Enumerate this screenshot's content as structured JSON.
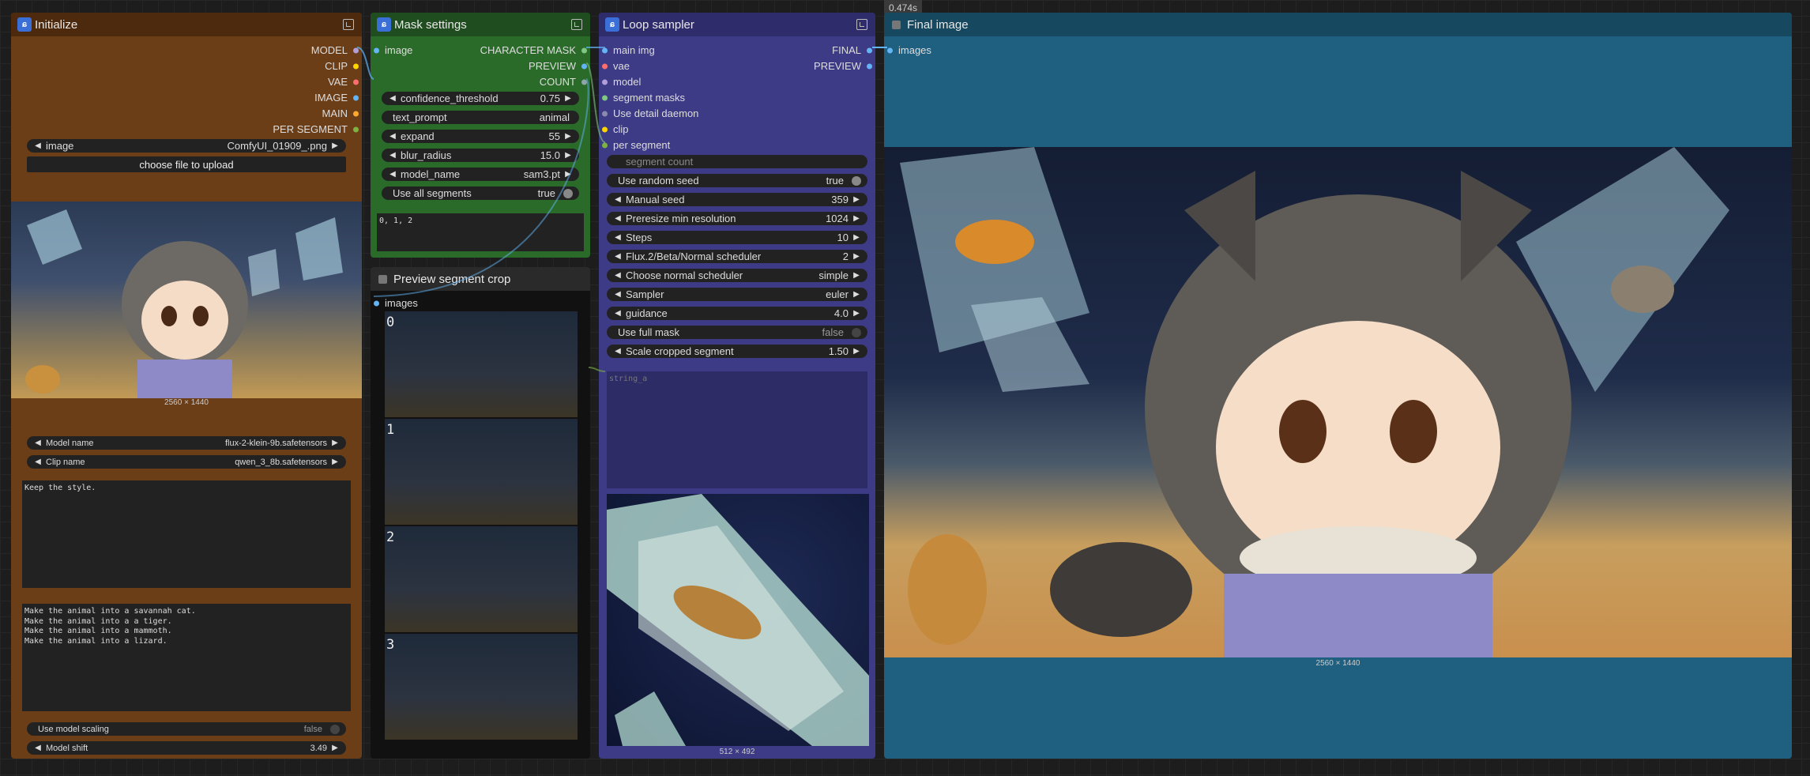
{
  "timer": "0.474s",
  "initialize": {
    "title": "Initialize",
    "outputs": [
      "MODEL",
      "CLIP",
      "VAE",
      "IMAGE",
      "MAIN",
      "PER SEGMENT"
    ],
    "image_widget": {
      "label": "image",
      "value": "ComfyUI_01909_.png"
    },
    "upload_label": "choose file to upload",
    "image_caption": "2560 × 1440",
    "model_name": {
      "label": "Model name",
      "value": "flux-2-klein-9b.safetensors"
    },
    "clip_name": {
      "label": "Clip name",
      "value": "qwen_3_8b.safetensors"
    },
    "prompt_main": "Keep the style.",
    "prompt_segments": "Make the animal into a savannah cat.\nMake the animal into a a tiger.\nMake the animal into a mammoth.\nMake the animal into a lizard.",
    "use_model_scaling": {
      "label": "Use model scaling",
      "value": "false"
    },
    "model_shift": {
      "label": "Model shift",
      "value": "3.49"
    }
  },
  "mask": {
    "title": "Mask settings",
    "input": "image",
    "outputs": [
      "CHARACTER MASK",
      "PREVIEW",
      "COUNT"
    ],
    "widgets": [
      {
        "label": "confidence_threshold",
        "value": "0.75"
      },
      {
        "label": "text_prompt",
        "value": "animal"
      },
      {
        "label": "expand",
        "value": "55"
      },
      {
        "label": "blur_radius",
        "value": "15.0"
      },
      {
        "label": "model_name",
        "value": "sam3.pt"
      },
      {
        "label": "Use all segments",
        "value": "true"
      }
    ],
    "textbox": "0, 1, 2"
  },
  "preview": {
    "title": "Preview segment crop",
    "input": "images",
    "labels": [
      "0",
      "1",
      "2",
      "3"
    ]
  },
  "loop": {
    "title": "Loop sampler",
    "inputs": [
      "main img",
      "vae",
      "model",
      "segment masks",
      "Use detail daemon",
      "clip",
      "per segment",
      "segment count"
    ],
    "outputs": [
      "FINAL",
      "PREVIEW"
    ],
    "widgets": [
      {
        "label": "Use random seed",
        "value": "true"
      },
      {
        "label": "Manual seed",
        "value": "359"
      },
      {
        "label": "Preresize min resolution",
        "value": "1024"
      },
      {
        "label": "Steps",
        "value": "10"
      },
      {
        "label": "Flux.2/Beta/Normal scheduler",
        "value": "2"
      },
      {
        "label": "Choose normal scheduler",
        "value": "simple"
      },
      {
        "label": "Sampler",
        "value": "euler"
      },
      {
        "label": "guidance",
        "value": "4.0"
      },
      {
        "label": "Use full mask",
        "value": "false"
      },
      {
        "label": "Scale cropped segment",
        "value": "1.50"
      }
    ],
    "string_placeholder": "string_a",
    "image_caption": "512 × 492"
  },
  "final": {
    "title": "Final image",
    "input": "images",
    "image_caption": "2560 × 1440"
  },
  "colors": {
    "initialize_body": "#6b3e17",
    "initialize_title": "#4d2a0e",
    "mask_body": "#2a6b2a",
    "mask_title": "#1f4d1f",
    "loop_body": "#3d3a86",
    "loop_title": "#2f2c6b",
    "final_body": "#1f5f80",
    "final_title": "#16485f",
    "preview_body": "#111111"
  }
}
